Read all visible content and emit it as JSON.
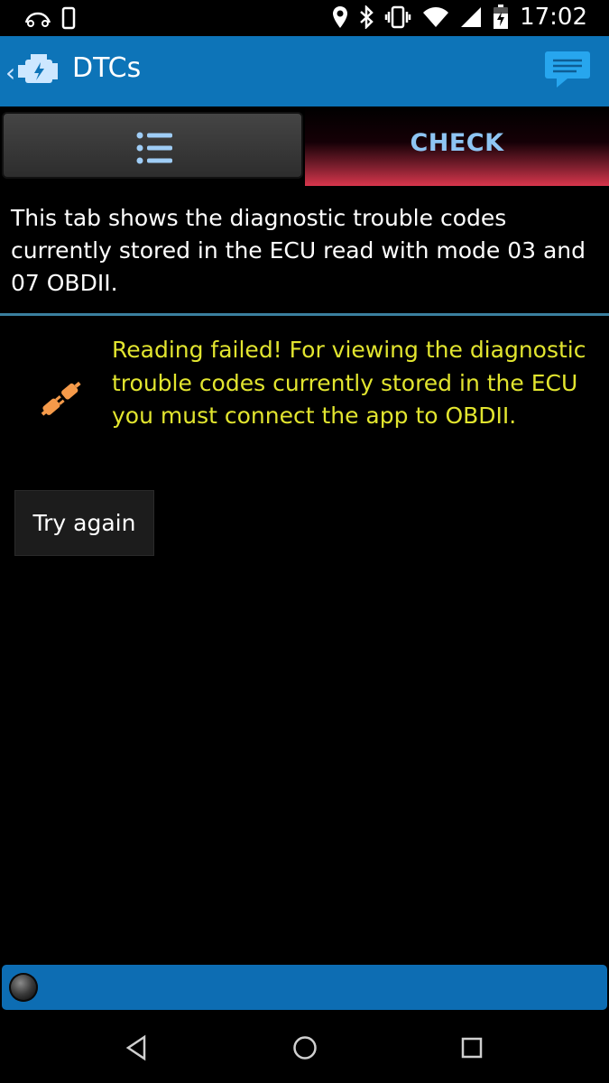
{
  "status_bar": {
    "time": "17:02",
    "icons": [
      "car-icon",
      "phone-outline-icon",
      "location-icon",
      "bluetooth-icon",
      "vibrate-icon",
      "wifi-icon",
      "signal-icon",
      "battery-icon"
    ]
  },
  "app_bar": {
    "title": "DTCs",
    "back_icon": "chevron-left-icon",
    "logo_icon": "check-engine-icon",
    "action_icon": "chat-message-icon",
    "color": "#0d74b8"
  },
  "tabs": [
    {
      "icon": "list-icon",
      "label": ""
    },
    {
      "label": "CHECK",
      "active": true
    }
  ],
  "info": {
    "text": "This tab shows the diagnostic trouble codes currently stored in the ECU read with mode 03 and 07 OBDII."
  },
  "error": {
    "icon": "plug-disconnected-icon",
    "message": "Reading failed! For viewing the diagnostic trouble codes currently stored in the ECU you must connect the app to OBDII.",
    "color": "#e2e52f"
  },
  "retry_button": {
    "label": "Try again"
  },
  "footer": {
    "indicator": "connection-led-icon",
    "color": "#0d6db3"
  },
  "nav": {
    "back": "nav-back-icon",
    "home": "nav-home-icon",
    "recent": "nav-recent-icon"
  }
}
